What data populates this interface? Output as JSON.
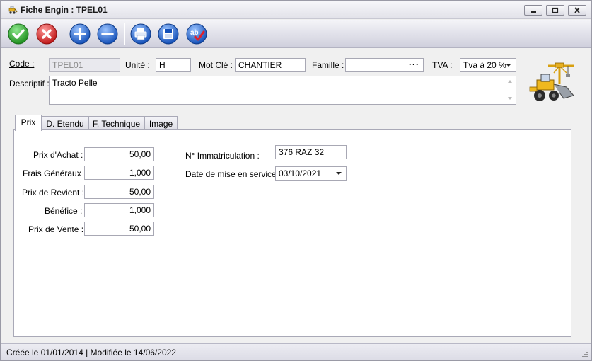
{
  "window": {
    "title": "Fiche Engin : TPEL01"
  },
  "toolbar": {
    "buttons": [
      "validate",
      "cancel",
      "add",
      "remove",
      "print",
      "save",
      "spellcheck"
    ]
  },
  "header": {
    "code_label": "Code :",
    "code_value": "TPEL01",
    "unite_label": "Unité :",
    "unite_value": "H",
    "motcle_label": "Mot Clé :",
    "motcle_value": "CHANTIER",
    "famille_label": "Famille :",
    "famille_value": "",
    "famille_button": "···",
    "tva_label": "TVA :",
    "tva_value": "Tva à 20 %",
    "descriptif_label": "Descriptif :",
    "descriptif_value": "Tracto Pelle"
  },
  "tabs": [
    {
      "label": "Prix",
      "active": true
    },
    {
      "label": "D. Etendu",
      "active": false
    },
    {
      "label": "F. Technique",
      "active": false
    },
    {
      "label": "Image",
      "active": false
    }
  ],
  "prix": {
    "achat_label": "Prix d'Achat :",
    "achat_value": "50,00",
    "frais_label": "Frais Généraux :",
    "frais_value": "1,000",
    "revient_label": "Prix de Revient :",
    "revient_value": "50,00",
    "benefice_label": "Bénéfice :",
    "benefice_value": "1,000",
    "vente_label": "Prix de Vente :",
    "vente_value": "50,00",
    "immat_label": "N° Immatriculation :",
    "immat_value": "376 RAZ 32",
    "mise_label": "Date de mise en service :",
    "mise_value": "03/10/2021"
  },
  "status": {
    "text": "Créée le 01/01/2014 | Modifiée le 14/06/2022"
  },
  "colors": {
    "validate": "#2eaa2e",
    "cancel": "#d9262c",
    "add_remove": "#1f63c9",
    "accent": "#c8c8d8"
  }
}
